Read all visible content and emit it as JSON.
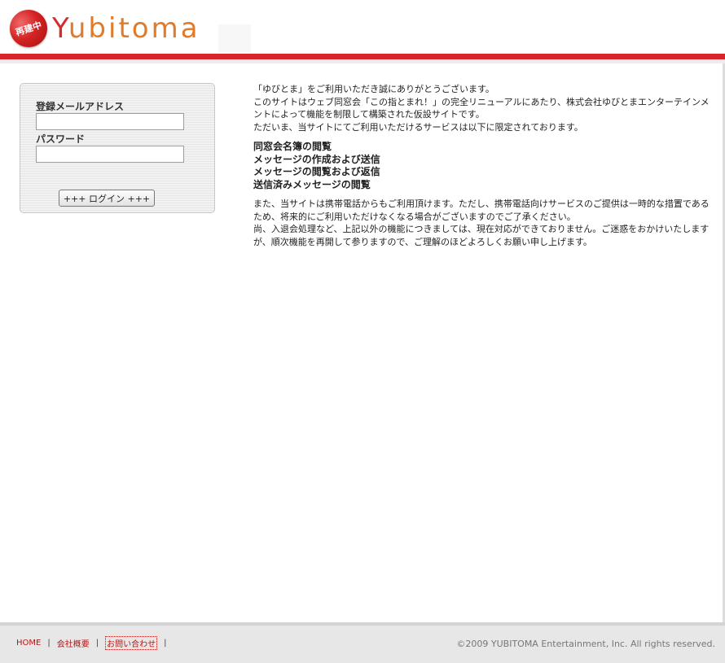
{
  "header": {
    "badge_text": "再建中",
    "brand_initial": "Y",
    "brand_rest": "ubitoma"
  },
  "login": {
    "email_label": "登録メールアドレス",
    "email_value": "",
    "password_label": "パスワード",
    "password_value": "",
    "button_label": "+++ ログイン +++"
  },
  "intro": [
    "「ゆびとま」をご利用いただき誠にありがとうございます。",
    "このサイトはウェブ同窓会「この指とまれ！」の完全リニューアルにあたり、株式会社ゆびとまエンターテインメントによって機能を制限して構築された仮設サイトです。",
    "ただいま、当サイトにてご利用いただけるサービスは以下に限定されております。"
  ],
  "features": [
    "同窓会名簿の閲覧",
    "メッセージの作成および送信",
    "メッセージの閲覧および返信",
    "送信済みメッセージの閲覧"
  ],
  "notes": [
    "また、当サイトは携帯電話からもご利用頂けます。ただし、携帯電話向けサービスのご提供は一時的な措置であるため、将来的にご利用いただけなくなる場合がございますのでご了承ください。",
    "尚、入退会処理など、上記以外の機能につきましては、現在対応ができておりません。ご迷惑をおかけいたしますが、順次機能を再開して参りますので、ご理解のほどよろしくお願い申し上げます。"
  ],
  "footer": {
    "links": [
      "HOME",
      "会社概要",
      "お問い合わせ"
    ],
    "separator": "|",
    "copyright": "©2009 YUBITOMA Entertainment, Inc. All rights reserved."
  },
  "colors": {
    "brand_red": "#d8252a",
    "brand_orange": "#e07b2a",
    "link_red": "#b21818"
  }
}
